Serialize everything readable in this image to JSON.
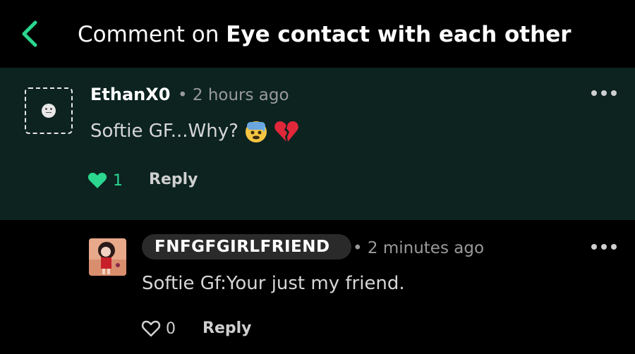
{
  "header": {
    "title_prefix": "Comment on",
    "title_post": "Eye contact with each other",
    "accent": "#2bd68f"
  },
  "comments": [
    {
      "username": "EthanX0",
      "time": "2 hours ago",
      "text": "Softie GF...Why?",
      "emojis": [
        "anxious-sweat-face",
        "broken-heart"
      ],
      "likes": "1",
      "liked": true,
      "reply_label": "Reply",
      "highlight": true
    },
    {
      "username": "FNFGFGIRLFRIEND",
      "time": "2 minutes ago",
      "text": "Softie Gf:Your just my friend.",
      "likes": "0",
      "liked": false,
      "reply_label": "Reply",
      "highlight": false
    }
  ],
  "colors": {
    "highlight_bg": "#0c2320",
    "like_active": "#2bd68f"
  }
}
